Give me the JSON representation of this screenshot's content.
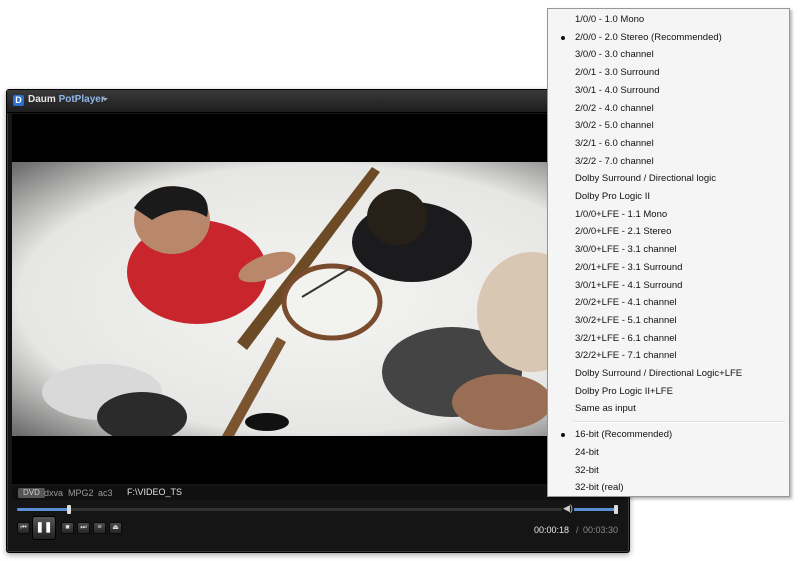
{
  "player": {
    "logo_letter": "D",
    "brand": "Daum",
    "product": "PotPlayer",
    "status": {
      "dvd_badge": "DVD",
      "codecs": [
        "dxva",
        "MPG2",
        "ac3"
      ],
      "path": "F:\\VIDEO_TS"
    },
    "seek_progress": 0.095,
    "volume_level": 0.95,
    "controls": {
      "prev": "⏮",
      "pause": "❚❚",
      "stop": "■",
      "next": "⏭",
      "playlist": "≡",
      "eject": "⏏"
    },
    "time_current": "00:00:18",
    "time_separator": "/",
    "time_total": "00:03:30"
  },
  "menu": {
    "channel_items": [
      {
        "label": "1/0/0 - 1.0 Mono",
        "checked": false
      },
      {
        "label": "2/0/0 - 2.0 Stereo (Recommended)",
        "checked": true
      },
      {
        "label": "3/0/0 - 3.0 channel",
        "checked": false
      },
      {
        "label": "2/0/1 - 3.0 Surround",
        "checked": false
      },
      {
        "label": "3/0/1 - 4.0 Surround",
        "checked": false
      },
      {
        "label": "2/0/2 - 4.0 channel",
        "checked": false
      },
      {
        "label": "3/0/2 - 5.0 channel",
        "checked": false
      },
      {
        "label": "3/2/1 - 6.0 channel",
        "checked": false
      },
      {
        "label": "3/2/2 - 7.0 channel",
        "checked": false
      },
      {
        "label": "Dolby Surround / Directional logic",
        "checked": false
      },
      {
        "label": "Dolby Pro Logic II",
        "checked": false
      },
      {
        "label": "1/0/0+LFE - 1.1 Mono",
        "checked": false
      },
      {
        "label": "2/0/0+LFE - 2.1 Stereo",
        "checked": false
      },
      {
        "label": "3/0/0+LFE - 3.1 channel",
        "checked": false
      },
      {
        "label": "2/0/1+LFE - 3.1 Surround",
        "checked": false
      },
      {
        "label": "3/0/1+LFE - 4.1 Surround",
        "checked": false
      },
      {
        "label": "2/0/2+LFE - 4.1 channel",
        "checked": false
      },
      {
        "label": "3/0/2+LFE - 5.1 channel",
        "checked": false
      },
      {
        "label": "3/2/1+LFE - 6.1 channel",
        "checked": false
      },
      {
        "label": "3/2/2+LFE - 7.1 channel",
        "checked": false
      },
      {
        "label": "Dolby Surround / Directional Logic+LFE",
        "checked": false
      },
      {
        "label": "Dolby Pro Logic II+LFE",
        "checked": false
      },
      {
        "label": "Same as input",
        "checked": false
      }
    ],
    "bitdepth_items": [
      {
        "label": "16-bit (Recommended)",
        "checked": true
      },
      {
        "label": "24-bit",
        "checked": false
      },
      {
        "label": "32-bit",
        "checked": false
      },
      {
        "label": "32-bit (real)",
        "checked": false
      }
    ]
  }
}
